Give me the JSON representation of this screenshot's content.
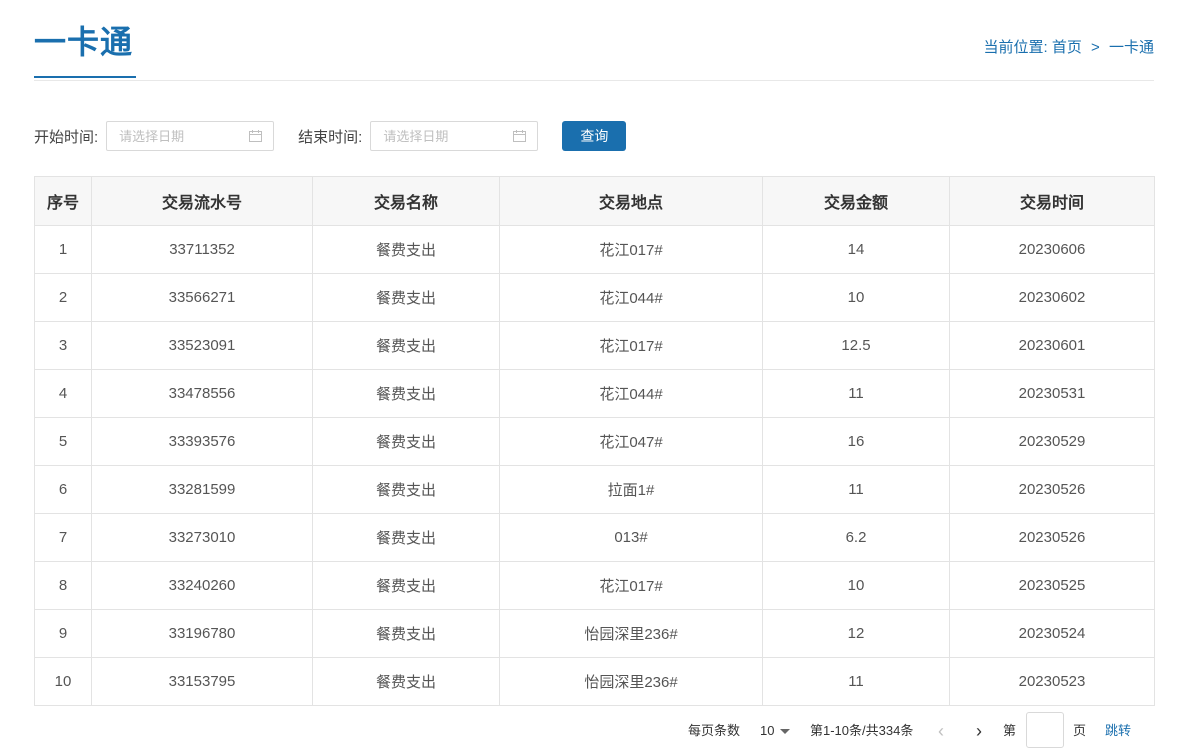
{
  "header": {
    "title": "一卡通",
    "breadcrumb_prefix": "当前位置:",
    "breadcrumb_home": "首页",
    "breadcrumb_sep": ">",
    "breadcrumb_current": "一卡通"
  },
  "filter": {
    "start_label": "开始时间:",
    "start_placeholder": "请选择日期",
    "start_value": "",
    "end_label": "结束时间:",
    "end_placeholder": "请选择日期",
    "end_value": "",
    "query_label": "查询"
  },
  "colors": {
    "accent": "#1a6fae",
    "header_bg": "#f7f7f7",
    "border": "#e3e3e3"
  },
  "table": {
    "columns": [
      "序号",
      "交易流水号",
      "交易名称",
      "交易地点",
      "交易金额",
      "交易时间"
    ],
    "rows": [
      [
        "1",
        "33711352",
        "餐费支出",
        "花江017#",
        "14",
        "20230606"
      ],
      [
        "2",
        "33566271",
        "餐费支出",
        "花江044#",
        "10",
        "20230602"
      ],
      [
        "3",
        "33523091",
        "餐费支出",
        "花江017#",
        "12.5",
        "20230601"
      ],
      [
        "4",
        "33478556",
        "餐费支出",
        "花江044#",
        "11",
        "20230531"
      ],
      [
        "5",
        "33393576",
        "餐费支出",
        "花江047#",
        "16",
        "20230529"
      ],
      [
        "6",
        "33281599",
        "餐费支出",
        "拉面1#",
        "11",
        "20230526"
      ],
      [
        "7",
        "33273010",
        "餐费支出",
        "013#",
        "6.2",
        "20230526"
      ],
      [
        "8",
        "33240260",
        "餐费支出",
        "花江017#",
        "10",
        "20230525"
      ],
      [
        "9",
        "33196780",
        "餐费支出",
        "怡园深里236#",
        "12",
        "20230524"
      ],
      [
        "10",
        "33153795",
        "餐费支出",
        "怡园深里236#",
        "11",
        "20230523"
      ]
    ]
  },
  "pager": {
    "size_label": "每页条数",
    "size_value": "10",
    "range_text": "第1-10条/共334条",
    "prev_icon": "chevron-left-icon",
    "next_icon": "chevron-right-icon",
    "jump_prefix": "第",
    "jump_value": "",
    "jump_suffix": "页",
    "go_label": "跳转"
  }
}
